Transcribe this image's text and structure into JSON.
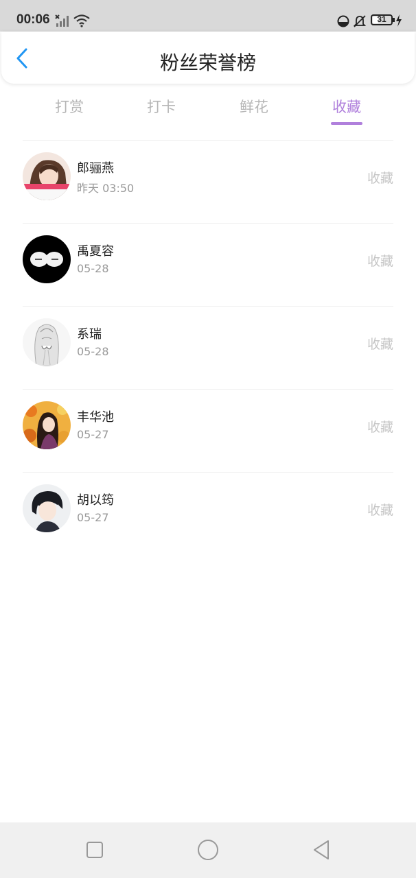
{
  "status_bar": {
    "time": "00:06",
    "battery_level": "31",
    "battery_fraction": 0.31,
    "icons": [
      "signal-off-icon",
      "wifi-icon",
      "clock-icon",
      "bell-muted-icon",
      "battery-icon",
      "charging-icon"
    ]
  },
  "header": {
    "title": "粉丝荣誉榜",
    "back_icon": "chevron-left-icon"
  },
  "tabs": [
    {
      "label": "打赏",
      "active": false
    },
    {
      "label": "打卡",
      "active": false
    },
    {
      "label": "鲜花",
      "active": false
    },
    {
      "label": "收藏",
      "active": true
    }
  ],
  "list": [
    {
      "name": "郎骊燕",
      "time": "昨天  03:50",
      "action": "收藏"
    },
    {
      "name": "禹夏容",
      "time": "05-28",
      "action": "收藏"
    },
    {
      "name": "系瑞",
      "time": "05-28",
      "action": "收藏"
    },
    {
      "name": "丰华池",
      "time": "05-27",
      "action": "收藏"
    },
    {
      "name": "胡以筠",
      "time": "05-27",
      "action": "收藏"
    }
  ],
  "colors": {
    "accent": "#b080dc",
    "back_arrow": "#2196f3",
    "muted_text": "#c6c6c6",
    "status_bar_bg": "#d9d9d9"
  },
  "nav_bar": {
    "icons": [
      "square-icon",
      "circle-icon",
      "triangle-back-icon"
    ]
  }
}
